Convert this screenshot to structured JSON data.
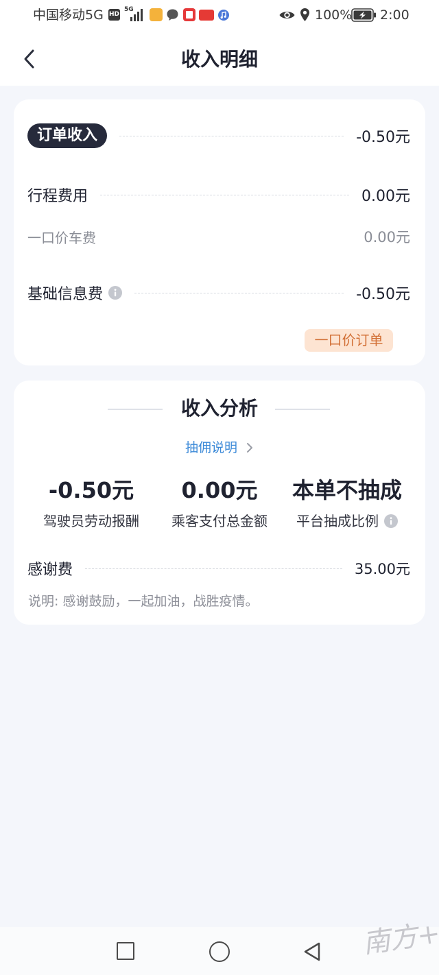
{
  "status_bar": {
    "carrier": "中国移动5G",
    "hd_badge": "HD",
    "network": "5G",
    "app_icons": [
      "yellow-app-icon",
      "chat-bubble-icon",
      "red-book-app-icon",
      "toutiao-app-icon",
      "music-app-icon"
    ],
    "right_icons": [
      "eye-icon",
      "location-pin-icon",
      "battery-charging-icon"
    ],
    "battery": "100%",
    "time": "2:00"
  },
  "header": {
    "back_icon": "chevron-left-icon",
    "title": "收入明细"
  },
  "income_card": {
    "order_income": {
      "label": "订单收入",
      "value": "-0.50元"
    },
    "trip_fee": {
      "label": "行程费用",
      "value": "0.00元"
    },
    "fixed_price_fare": {
      "label": "一口价车费",
      "value": "0.00元"
    },
    "info_fee": {
      "label": "基础信息费",
      "value": "-0.50元",
      "icon": "info-icon"
    },
    "tag": "一口价订单"
  },
  "analysis_card": {
    "title": "收入分析",
    "commission_link": "抽佣说明",
    "stats": [
      {
        "value": "-0.50元",
        "label": "驾驶员劳动报酬"
      },
      {
        "value": "0.00元",
        "label": "乘客支付总金额"
      },
      {
        "value": "本单不抽成",
        "label": "平台抽成比例",
        "icon": "info-icon"
      }
    ],
    "thanks_fee": {
      "label": "感谢费",
      "value": "35.00元"
    },
    "note": "说明: 感谢鼓励，一起加油，战胜疫情。"
  },
  "nav_bar": {
    "recent_icon": "square-icon",
    "home_icon": "circle-icon",
    "back_icon": "triangle-back-icon"
  },
  "watermark": "南方+",
  "colors": {
    "background": "#f4f6fb",
    "pill": "#262a3b",
    "tag_bg": "#fde4d2",
    "tag_text": "#d27036",
    "link": "#3c8ad8"
  }
}
